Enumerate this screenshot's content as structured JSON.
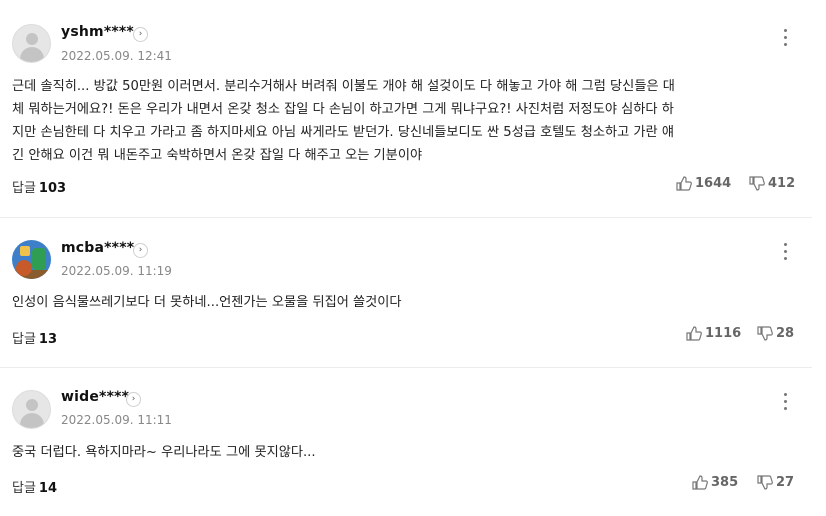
{
  "comments": [
    {
      "nickname": "yshm****",
      "date": "2022.05.09. 12:41",
      "text": "근데 솔직히... 방값 50만원 이러면서. 분리수거해사 버려줘 이불도 개야 해 설겆이도 다 해놓고 가야 해 그럼 당신들은 대\n체 뭐하는거에요?! 돈은 우리가 내면서 온갖 청소 잡일 다 손님이 하고가면 그게 뭐냐구요?! 사진처럼 저정도야 심하다 하\n지만 손님한테 다 치우고 가라고 좀 하지마세요 아님 싸게라도 받던가. 당신네들보디도 싼 5성급 호텔도 청소하고 가란 얘\n긴 안해요 이건 뭐 내돈주고 숙박하면서 온갖 잡일 다 해주고 오는 기분이야",
      "reply_label": "답글",
      "reply_count": "103",
      "likes": "1644",
      "dislikes": "412",
      "avatar": "default-avatar"
    },
    {
      "nickname": "mcba****",
      "date": "2022.05.09. 11:19",
      "text": "인성이 음식물쓰레기보다 더 못하네...언젠가는 오물을 뒤집어 쓸것이다",
      "reply_label": "답글",
      "reply_count": "13",
      "likes": "1116",
      "dislikes": "28",
      "avatar": "photo-avatar"
    },
    {
      "nickname": "wide****",
      "date": "2022.05.09. 11:11",
      "text": "중국 더럽다. 욕하지마라~ 우리나라도 그에 못지않다...",
      "reply_label": "답글",
      "reply_count": "14",
      "likes": "385",
      "dislikes": "27",
      "avatar": "default-avatar"
    }
  ],
  "icons": {
    "profile_button": "chevron-right-icon",
    "more": "more-vertical-icon",
    "like": "thumbs-up-icon",
    "dislike": "thumbs-down-icon"
  },
  "colors": {
    "text": "#222222",
    "meta": "#888888",
    "divider": "#ececec"
  }
}
